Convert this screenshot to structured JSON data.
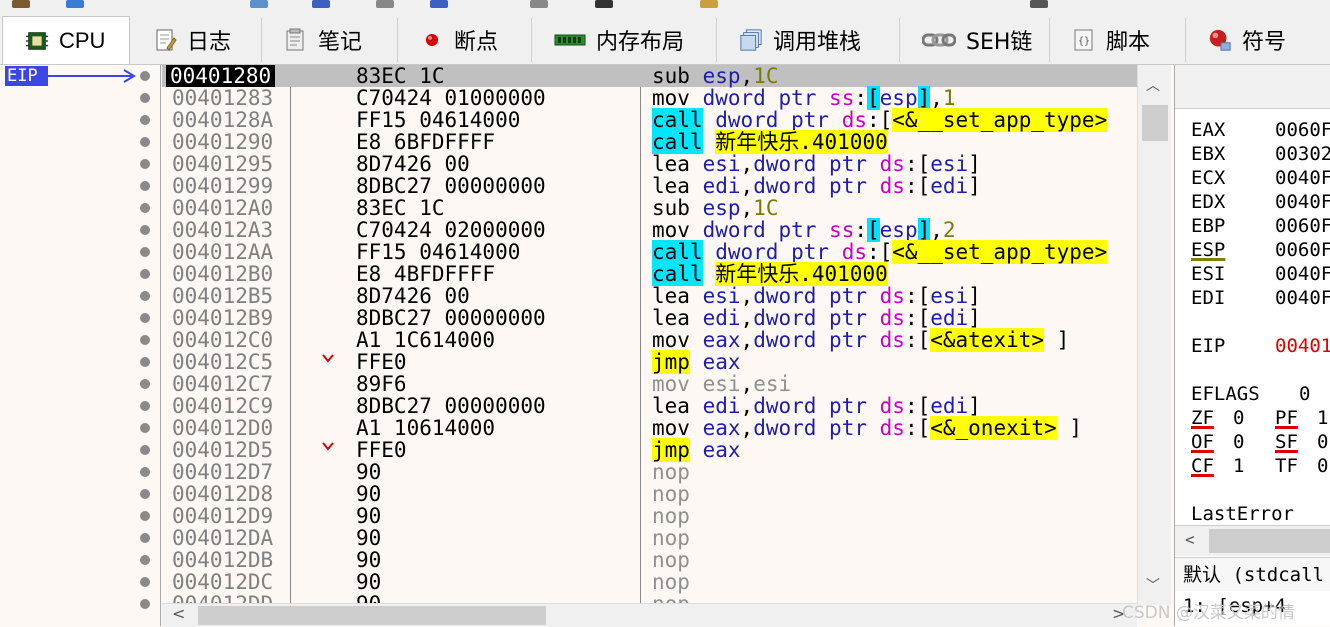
{
  "tabs": [
    {
      "label": "CPU",
      "icon": "cpu-icon",
      "active": true
    },
    {
      "label": "日志",
      "icon": "log-icon"
    },
    {
      "label": "笔记",
      "icon": "notes-icon"
    },
    {
      "label": "断点",
      "icon": "breakpoint-icon"
    },
    {
      "label": "内存布局",
      "icon": "memory-map-icon"
    },
    {
      "label": "调用堆栈",
      "icon": "call-stack-icon"
    },
    {
      "label": "SEH链",
      "icon": "seh-chain-icon"
    },
    {
      "label": "脚本",
      "icon": "script-icon"
    },
    {
      "label": "符号",
      "icon": "symbols-icon"
    }
  ],
  "eip_label": "EIP",
  "disasm": [
    {
      "addr": "00401280",
      "bytes": "83EC 1C",
      "selected": true
    },
    {
      "addr": "00401283",
      "bytes": "C70424 01000000"
    },
    {
      "addr": "0040128A",
      "bytes": "FF15 04614000"
    },
    {
      "addr": "00401290",
      "bytes": "E8 6BFDFFFF"
    },
    {
      "addr": "00401295",
      "bytes": "8D7426 00"
    },
    {
      "addr": "00401299",
      "bytes": "8DBC27 00000000"
    },
    {
      "addr": "004012A0",
      "bytes": "83EC 1C"
    },
    {
      "addr": "004012A3",
      "bytes": "C70424 02000000"
    },
    {
      "addr": "004012AA",
      "bytes": "FF15 04614000"
    },
    {
      "addr": "004012B0",
      "bytes": "E8 4BFDFFFF"
    },
    {
      "addr": "004012B5",
      "bytes": "8D7426 00"
    },
    {
      "addr": "004012B9",
      "bytes": "8DBC27 00000000"
    },
    {
      "addr": "004012C0",
      "bytes": "A1 1C614000"
    },
    {
      "addr": "004012C5",
      "bytes": "FFE0",
      "jump_mark": true
    },
    {
      "addr": "004012C7",
      "bytes": "89F6"
    },
    {
      "addr": "004012C9",
      "bytes": "8DBC27 00000000"
    },
    {
      "addr": "004012D0",
      "bytes": "A1 10614000"
    },
    {
      "addr": "004012D5",
      "bytes": "FFE0",
      "jump_mark": true
    },
    {
      "addr": "004012D7",
      "bytes": "90"
    },
    {
      "addr": "004012D8",
      "bytes": "90"
    },
    {
      "addr": "004012D9",
      "bytes": "90"
    },
    {
      "addr": "004012DA",
      "bytes": "90"
    },
    {
      "addr": "004012DB",
      "bytes": "90"
    },
    {
      "addr": "004012DC",
      "bytes": "90"
    },
    {
      "addr": "004012DD",
      "bytes": "90"
    }
  ],
  "instr_tokens": {
    "sub": "sub",
    "mov": "mov",
    "lea": "lea",
    "call": "call",
    "jmp": "jmp",
    "nop": "nop",
    "esp": "esp",
    "esi": "esi",
    "edi": "edi",
    "eax": "eax",
    "dword_ptr": "dword ptr",
    "ss": "ss",
    "ds": "ds",
    "imm_1C": "1C",
    "imm_1": "1",
    "imm_2": "2",
    "set_app_type": "<&__set_app_type>",
    "target_401000": "新年快乐.401000",
    "atexit": "<&atexit>",
    "onexit": "<&_onexit>"
  },
  "registers": [
    {
      "name": "EAX",
      "value": "0060F"
    },
    {
      "name": "EBX",
      "value": "00302"
    },
    {
      "name": "ECX",
      "value": "0040F"
    },
    {
      "name": "EDX",
      "value": "0040F"
    },
    {
      "name": "EBP",
      "value": "0060F"
    },
    {
      "name": "ESP",
      "value": "0060F"
    },
    {
      "name": "ESI",
      "value": "0040F"
    },
    {
      "name": "EDI",
      "value": "0040F"
    }
  ],
  "eip_reg": {
    "name": "EIP",
    "value": "00401"
  },
  "eflags": {
    "name": "EFLAGS",
    "value": "0"
  },
  "flags": [
    {
      "name": "ZF",
      "value": "0"
    },
    {
      "name": "PF",
      "value": "1"
    },
    {
      "name": "OF",
      "value": "0"
    },
    {
      "name": "SF",
      "value": "0"
    },
    {
      "name": "CF",
      "value": "1"
    },
    {
      "name": "TF",
      "value": "0"
    }
  ],
  "last_error": "LastError",
  "call_conv": "默认 (stdcall",
  "stack_line": "1: [esp+4",
  "watermark": "CSDN @汉菜又菜的情",
  "colors": {
    "eip_bg": "#3c46e8",
    "call_hl": "#00e6ff",
    "jmp_hl": "#ffff00",
    "segment": "#c800c8",
    "register": "#1e1ea8",
    "immediate": "#7a7a00"
  }
}
